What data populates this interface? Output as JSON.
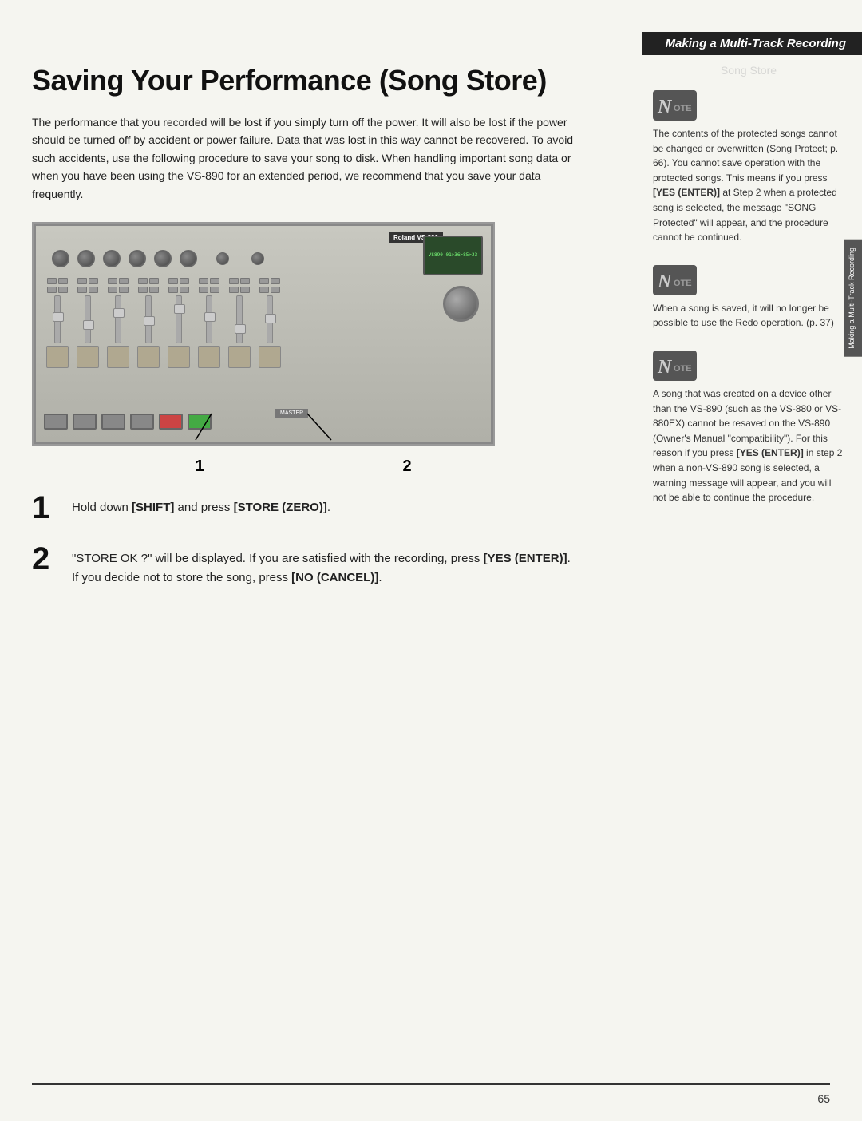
{
  "header": {
    "title": "Making a Multi-Track Recording"
  },
  "side_tab": {
    "text": "Making a Multi-Track Recording"
  },
  "page_title": "Saving Your Performance (Song Store)",
  "faded_header": "Song Store",
  "intro_paragraph": "The performance that you recorded will be lost if you simply turn off the power. It will also be lost if the power should be turned off by accident or power failure. Data that was lost in this way cannot be recovered. To avoid such accidents, use the following procedure to save your song to disk. When handling important song data or when you have been using the VS-890 for an extended period, we recommend that you save your data frequently.",
  "device": {
    "label": "Roland VS-890",
    "display_text": "VS890 01>36>85>23"
  },
  "image_labels": {
    "label1": "1",
    "label2": "2"
  },
  "steps": [
    {
      "number": "1",
      "text_parts": [
        {
          "text": "Hold down ",
          "bold": false
        },
        {
          "text": "[SHIFT]",
          "bold": true
        },
        {
          "text": " and press ",
          "bold": false
        },
        {
          "text": "[STORE (ZERO)]",
          "bold": true
        },
        {
          "text": ".",
          "bold": false
        }
      ]
    },
    {
      "number": "2",
      "text_parts": [
        {
          "text": "“STORE OK ?” will be displayed. If you are satisfied with the recording, press ",
          "bold": false
        },
        {
          "text": "[YES (ENTER)]",
          "bold": true
        },
        {
          "text": ". If you decide not to store the song, press ",
          "bold": false
        },
        {
          "text": "[NO (CANCEL)]",
          "bold": true
        },
        {
          "text": ".",
          "bold": false
        }
      ]
    }
  ],
  "notes": [
    {
      "id": "note1",
      "text": "The contents of the protected songs cannot be changed or overwritten (Song Protect; p. 66). You cannot save operation with the protected songs. This means if you press [YES (ENTER)] at Step 2 when a protected song is selected, the message \"SONG Protected\" will appear, and the procedure cannot be continued."
    },
    {
      "id": "note2",
      "text": "When a song is saved, it will no longer be possible to use the Redo operation. (p. 37)"
    },
    {
      "id": "note3",
      "text": "A song that was created on a device other than the VS-890 (such as the VS-880 or VS-880EX) cannot be resaved on the VS-890 (Owner’s Manual “compatibility”). For this reason if you press [YES (ENTER)] in step 2 when a non-VS-890 song is selected, a warning message will appear, and you will not be able to continue the procedure."
    }
  ],
  "page_number": "65"
}
